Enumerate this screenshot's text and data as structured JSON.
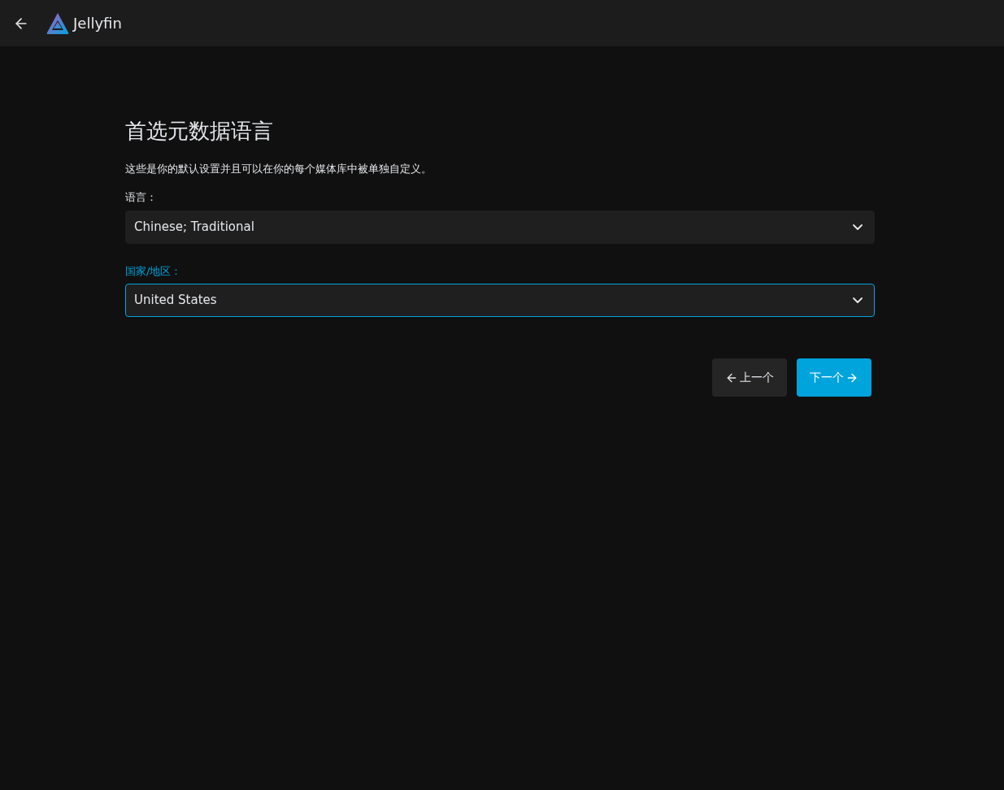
{
  "header": {
    "app_name": "Jellyfin"
  },
  "page": {
    "title": "首选元数据语言",
    "description": "这些是你的默认设置并且可以在你的每个媒体库中被单独自定义。"
  },
  "fields": [
    {
      "label": "语言：",
      "value": "Chinese; Traditional",
      "focused": false
    },
    {
      "label": "国家/地区：",
      "value": "United States",
      "focused": true
    }
  ],
  "buttons": [
    {
      "label": "上一个",
      "kind": "previous"
    },
    {
      "label": "下一个",
      "kind": "next"
    }
  ]
}
